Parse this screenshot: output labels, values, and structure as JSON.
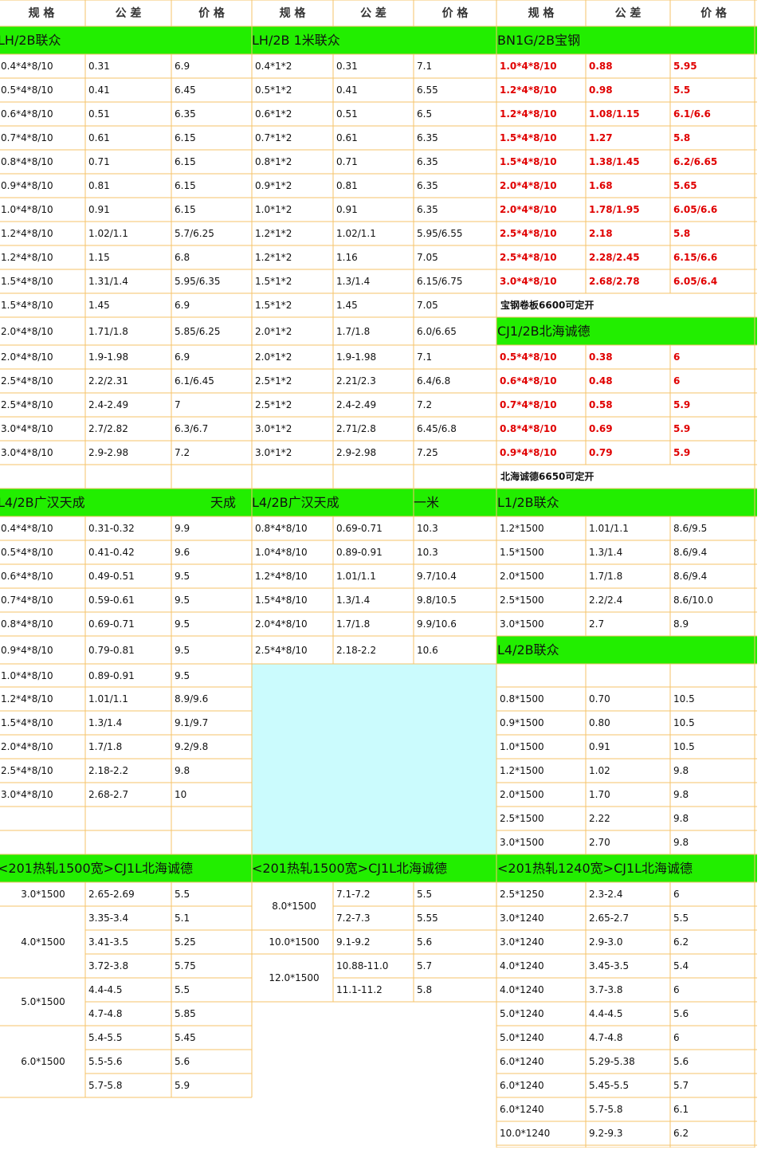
{
  "colors": {
    "grid": "#f5c36a",
    "section_bg": "#22ee00",
    "aqua": "#cbfbfd",
    "red": "#e00000"
  },
  "header": {
    "left": [
      "规 格",
      "公 差",
      "价 格"
    ],
    "middle": [
      "规 格",
      "公 差",
      "价 格"
    ],
    "right": [
      "规 格",
      "公 差",
      "价 格"
    ]
  },
  "sections": {
    "lh2b": "LH/2B联众",
    "lh2b_1m": "LH/2B 1米联众",
    "bn1g": "BN1G/2B宝钢",
    "cj1": "CJ1/2B北海诚德",
    "l4_left": "L4/2B广汉天成",
    "l4_left_tag": "天成",
    "l4_mid": "L4/2B广汉天成",
    "l4_mid_tag": "一米",
    "l1": "L1/2B联众",
    "l4_right": "L4/2B联众",
    "hot_left": "<201热轧1500宽>CJ1L北海诚德",
    "hot_mid": "<201热轧1500宽>CJ1L北海诚德",
    "hot_right": "<201热轧1240宽>CJ1L北海诚德"
  },
  "notes": {
    "baosteel": "宝钢卷板6600可定开",
    "beihai": "北海诚德6650可定开"
  },
  "lh2b_rows": [
    [
      "0.4*4*8/10",
      "0.31",
      "6.9"
    ],
    [
      "0.5*4*8/10",
      "0.41",
      "6.45"
    ],
    [
      "0.6*4*8/10",
      "0.51",
      "6.35"
    ],
    [
      "0.7*4*8/10",
      "0.61",
      "6.15"
    ],
    [
      "0.8*4*8/10",
      "0.71",
      "6.15"
    ],
    [
      "0.9*4*8/10",
      "0.81",
      "6.15"
    ],
    [
      "1.0*4*8/10",
      "0.91",
      "6.15"
    ],
    [
      "1.2*4*8/10",
      "1.02/1.1",
      "5.7/6.25"
    ],
    [
      "1.2*4*8/10",
      "1.15",
      "6.8"
    ],
    [
      "1.5*4*8/10",
      "1.31/1.4",
      "5.95/6.35"
    ],
    [
      "1.5*4*8/10",
      "1.45",
      "6.9"
    ],
    [
      "2.0*4*8/10",
      "1.71/1.8",
      "5.85/6.25"
    ],
    [
      "2.0*4*8/10",
      "1.9-1.98",
      "6.9"
    ],
    [
      "2.5*4*8/10",
      "2.2/2.31",
      "6.1/6.45"
    ],
    [
      "2.5*4*8/10",
      "2.4-2.49",
      "7"
    ],
    [
      "3.0*4*8/10",
      "2.7/2.82",
      "6.3/6.7"
    ],
    [
      "3.0*4*8/10",
      "2.9-2.98",
      "7.2"
    ]
  ],
  "lh2b_1m_rows": [
    [
      "0.4*1*2",
      "0.31",
      "7.1"
    ],
    [
      "0.5*1*2",
      "0.41",
      "6.55"
    ],
    [
      "0.6*1*2",
      "0.51",
      "6.5"
    ],
    [
      "0.7*1*2",
      "0.61",
      "6.35"
    ],
    [
      "0.8*1*2",
      "0.71",
      "6.35"
    ],
    [
      "0.9*1*2",
      "0.81",
      "6.35"
    ],
    [
      "1.0*1*2",
      "0.91",
      "6.35"
    ],
    [
      "1.2*1*2",
      "1.02/1.1",
      "5.95/6.55"
    ],
    [
      "1.2*1*2",
      "1.16",
      "7.05"
    ],
    [
      "1.5*1*2",
      "1.3/1.4",
      "6.15/6.75"
    ],
    [
      "1.5*1*2",
      "1.45",
      "7.05"
    ],
    [
      "2.0*1*2",
      "1.7/1.8",
      "6.0/6.65"
    ],
    [
      "2.0*1*2",
      "1.9-1.98",
      "7.1"
    ],
    [
      "2.5*1*2",
      "2.21/2.3",
      "6.4/6.8"
    ],
    [
      "2.5*1*2",
      "2.4-2.49",
      "7.2"
    ],
    [
      "3.0*1*2",
      "2.71/2.8",
      "6.45/6.8"
    ],
    [
      "3.0*1*2",
      "2.9-2.98",
      "7.25"
    ]
  ],
  "bn1g_rows": [
    [
      "1.0*4*8/10",
      "0.88",
      "5.95"
    ],
    [
      "1.2*4*8/10",
      "0.98",
      "5.5"
    ],
    [
      "1.2*4*8/10",
      "1.08/1.15",
      "6.1/6.6"
    ],
    [
      "1.5*4*8/10",
      "1.27",
      "5.8"
    ],
    [
      "1.5*4*8/10",
      "1.38/1.45",
      "6.2/6.65"
    ],
    [
      "2.0*4*8/10",
      "1.68",
      "5.65"
    ],
    [
      "2.0*4*8/10",
      "1.78/1.95",
      "6.05/6.6"
    ],
    [
      "2.5*4*8/10",
      "2.18",
      "5.8"
    ],
    [
      "2.5*4*8/10",
      "2.28/2.45",
      "6.15/6.6"
    ],
    [
      "3.0*4*8/10",
      "2.68/2.78",
      "6.05/6.4"
    ]
  ],
  "cj1_rows": [
    [
      "0.5*4*8/10",
      "0.38",
      "6"
    ],
    [
      "0.6*4*8/10",
      "0.48",
      "6"
    ],
    [
      "0.7*4*8/10",
      "0.58",
      "5.9"
    ],
    [
      "0.8*4*8/10",
      "0.69",
      "5.9"
    ],
    [
      "0.9*4*8/10",
      "0.79",
      "5.9"
    ]
  ],
  "l4_left_rows": [
    [
      "0.4*4*8/10",
      "0.31-0.32",
      "9.9"
    ],
    [
      "0.5*4*8/10",
      "0.41-0.42",
      "9.6"
    ],
    [
      "0.6*4*8/10",
      "0.49-0.51",
      "9.5"
    ],
    [
      "0.7*4*8/10",
      "0.59-0.61",
      "9.5"
    ],
    [
      "0.8*4*8/10",
      "0.69-0.71",
      "9.5"
    ],
    [
      "0.9*4*8/10",
      "0.79-0.81",
      "9.5"
    ],
    [
      "1.0*4*8/10",
      "0.89-0.91",
      "9.5"
    ],
    [
      "1.2*4*8/10",
      "1.01/1.1",
      "8.9/9.6"
    ],
    [
      "1.5*4*8/10",
      "1.3/1.4",
      "9.1/9.7"
    ],
    [
      "2.0*4*8/10",
      "1.7/1.8",
      "9.2/9.8"
    ],
    [
      "2.5*4*8/10",
      "2.18-2.2",
      "9.8"
    ],
    [
      "3.0*4*8/10",
      "2.68-2.7",
      "10"
    ]
  ],
  "l4_mid_rows": [
    [
      "0.8*4*8/10",
      "0.69-0.71",
      "10.3"
    ],
    [
      "1.0*4*8/10",
      "0.89-0.91",
      "10.3"
    ],
    [
      "1.2*4*8/10",
      "1.01/1.1",
      "9.7/10.4"
    ],
    [
      "1.5*4*8/10",
      "1.3/1.4",
      "9.8/10.5"
    ],
    [
      "2.0*4*8/10",
      "1.7/1.8",
      "9.9/10.6"
    ],
    [
      "2.5*4*8/10",
      "2.18-2.2",
      "10.6"
    ]
  ],
  "l1_rows": [
    [
      "1.2*1500",
      "1.01/1.1",
      "8.6/9.5"
    ],
    [
      "1.5*1500",
      "1.3/1.4",
      "8.6/9.4"
    ],
    [
      "2.0*1500",
      "1.7/1.8",
      "8.6/9.4"
    ],
    [
      "2.5*1500",
      "2.2/2.4",
      "8.6/10.0"
    ],
    [
      "3.0*1500",
      "2.7",
      "8.9"
    ]
  ],
  "l4_right_rows": [
    [
      "0.8*1500",
      "0.70",
      "10.5"
    ],
    [
      "0.9*1500",
      "0.80",
      "10.5"
    ],
    [
      "1.0*1500",
      "0.91",
      "10.5"
    ],
    [
      "1.2*1500",
      "1.02",
      "9.8"
    ],
    [
      "2.0*1500",
      "1.70",
      "9.8"
    ],
    [
      "2.5*1500",
      "2.22",
      "9.8"
    ],
    [
      "3.0*1500",
      "2.70",
      "9.8"
    ]
  ],
  "hot_left_rows": [
    [
      "3.0*1500",
      "2.65-2.69",
      "5.5"
    ],
    [
      "4.0*1500",
      "3.35-3.4",
      "5.1"
    ],
    [
      "",
      "3.41-3.5",
      "5.25"
    ],
    [
      "",
      "3.72-3.8",
      "5.75"
    ],
    [
      "5.0*1500",
      "4.4-4.5",
      "5.5"
    ],
    [
      "",
      "4.7-4.8",
      "5.85"
    ],
    [
      "6.0*1500",
      "5.4-5.5",
      "5.45"
    ],
    [
      "",
      "5.5-5.6",
      "5.6"
    ],
    [
      "",
      "5.7-5.8",
      "5.9"
    ]
  ],
  "hot_mid_rows": [
    [
      "8.0*1500",
      "7.1-7.2",
      "5.5"
    ],
    [
      "",
      "7.2-7.3",
      "5.55"
    ],
    [
      "10.0*1500",
      "9.1-9.2",
      "5.6"
    ],
    [
      "12.0*1500",
      "10.88-11.0",
      "5.7"
    ],
    [
      "",
      "11.1-11.2",
      "5.8"
    ]
  ],
  "hot_right_rows": [
    [
      "2.5*1250",
      "2.3-2.4",
      "6"
    ],
    [
      "3.0*1240",
      "2.65-2.7",
      "5.5"
    ],
    [
      "3.0*1240",
      "2.9-3.0",
      "6.2"
    ],
    [
      "4.0*1240",
      "3.45-3.5",
      "5.4"
    ],
    [
      "4.0*1240",
      "3.7-3.8",
      "6"
    ],
    [
      "5.0*1240",
      "4.4-4.5",
      "5.6"
    ],
    [
      "5.0*1240",
      "4.7-4.8",
      "6"
    ],
    [
      "6.0*1240",
      "5.29-5.38",
      "5.6"
    ],
    [
      "6.0*1240",
      "5.45-5.5",
      "5.7"
    ],
    [
      "6.0*1240",
      "5.7-5.8",
      "6.1"
    ],
    [
      "10.0*1240",
      "9.2-9.3",
      "6.2"
    ]
  ]
}
